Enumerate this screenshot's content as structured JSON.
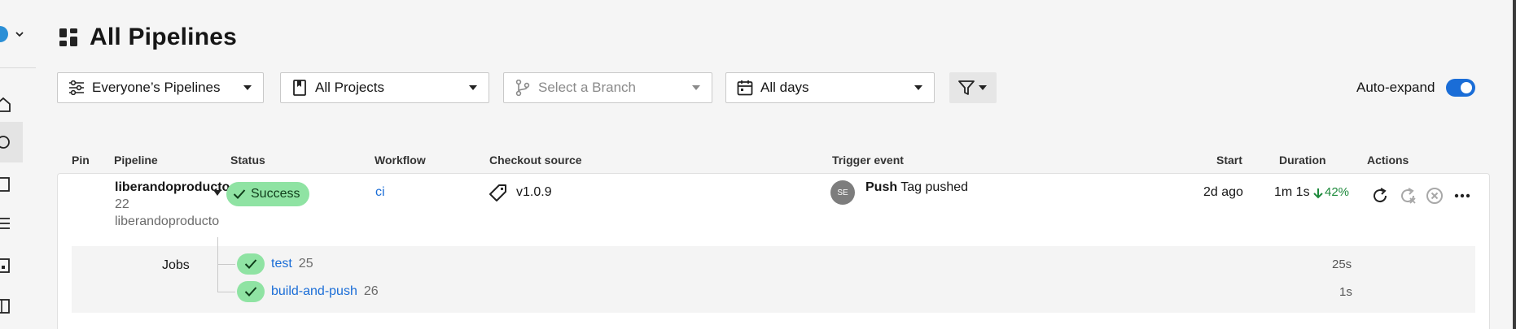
{
  "page": {
    "title": "All Pipelines"
  },
  "filters": {
    "pipelines": "Everyone’s Pipelines",
    "projects": "All Projects",
    "branch_placeholder": "Select a Branch",
    "days": "All days"
  },
  "auto_expand": {
    "label": "Auto-expand",
    "enabled": true
  },
  "table": {
    "headers": {
      "pin": "Pin",
      "pipeline": "Pipeline",
      "status": "Status",
      "workflow": "Workflow",
      "checkout": "Checkout source",
      "trigger": "Trigger event",
      "start": "Start",
      "duration": "Duration",
      "actions": "Actions"
    }
  },
  "pipeline": {
    "project": "liberandoproducto",
    "number": "22",
    "org": "liberandoproducto",
    "status": "Success",
    "workflow": "ci",
    "checkout": "v1.0.9",
    "trigger_avatar": "SE",
    "trigger_event": "Push",
    "trigger_detail": "Tag pushed",
    "start": "2d ago",
    "duration": "1m 1s",
    "duration_change": "42%"
  },
  "jobs": {
    "label": "Jobs",
    "items": [
      {
        "name": "test",
        "number": "25",
        "duration": "25s"
      },
      {
        "name": "build-and-push",
        "number": "26",
        "duration": "1s"
      }
    ]
  },
  "colors": {
    "accent": "#1a6dd7",
    "success_bg": "#8fe3a3",
    "success_text": "#0f3c1a",
    "duration_good": "#1e8a3c"
  }
}
